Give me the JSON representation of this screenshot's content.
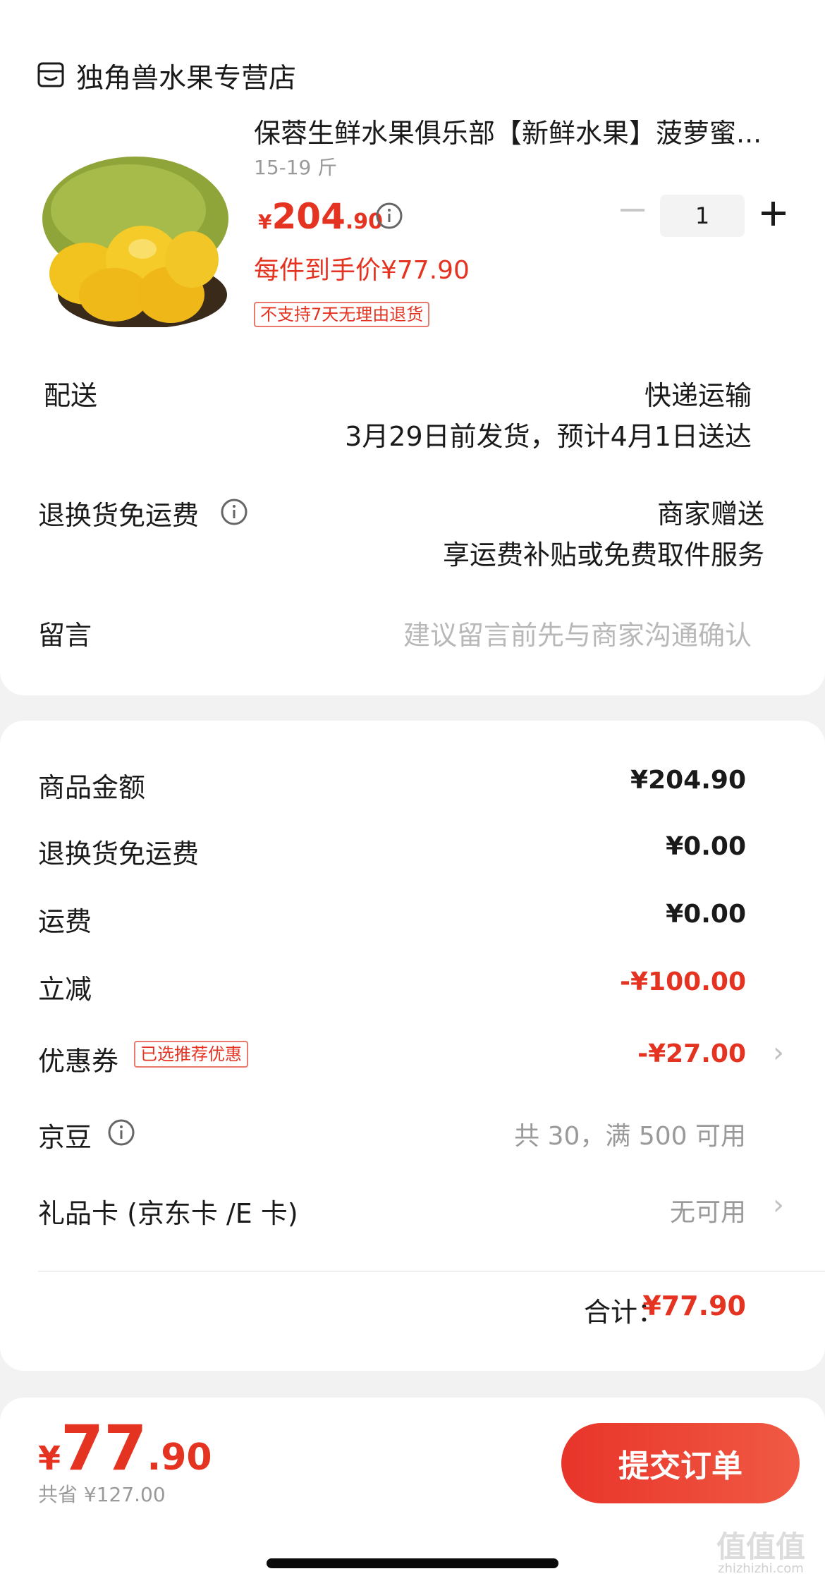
{
  "store": {
    "name": "独角兽水果专营店",
    "icon": "store-icon"
  },
  "product": {
    "title": "保蓉生鲜水果俱乐部【新鲜水果】菠萝蜜...",
    "spec": "15-19 斤",
    "price_currency": "¥",
    "price_integer": "204",
    "price_decimal": ".90",
    "unit_price": "每件到手价¥77.90",
    "return_badge": "不支持7天无理由退货",
    "quantity": "1",
    "image_icon": "jackfruit-image"
  },
  "delivery": {
    "label": "配送",
    "method": "快递运输",
    "eta": "3月29日前发货，预计4月1日送达"
  },
  "return_shipping": {
    "label": "退换货免运费",
    "provider": "商家赠送",
    "description": "享运费补贴或免费取件服务"
  },
  "message": {
    "label": "留言",
    "placeholder": "建议留言前先与商家沟通确认"
  },
  "cost": {
    "goods_label": "商品金额",
    "goods_value": "¥204.90",
    "return_fee_label": "退换货免运费",
    "return_fee_value": "¥0.00",
    "shipping_label": "运费",
    "shipping_value": "¥0.00",
    "discount_label": "立减",
    "discount_value": "-¥100.00",
    "coupon_label": "优惠券",
    "coupon_badge": "已选推荐优惠",
    "coupon_value": "-¥27.00",
    "jingdou_label": "京豆",
    "jingdou_value": "共 30，满 500 可用",
    "giftcard_label": "礼品卡 (京东卡 /E 卡)",
    "giftcard_value": "无可用",
    "total_label": "合计：",
    "total_value": "¥77.90"
  },
  "bottom": {
    "currency": "¥",
    "price_integer": "77",
    "price_decimal": ".90",
    "saved": "共省 ¥127.00",
    "submit_label": "提交订单"
  },
  "watermark": {
    "text": "值值值",
    "sub": "zhizhizhi.com"
  },
  "colors": {
    "accent": "#e53322",
    "background": "#f2f2f2",
    "muted": "#999999"
  }
}
